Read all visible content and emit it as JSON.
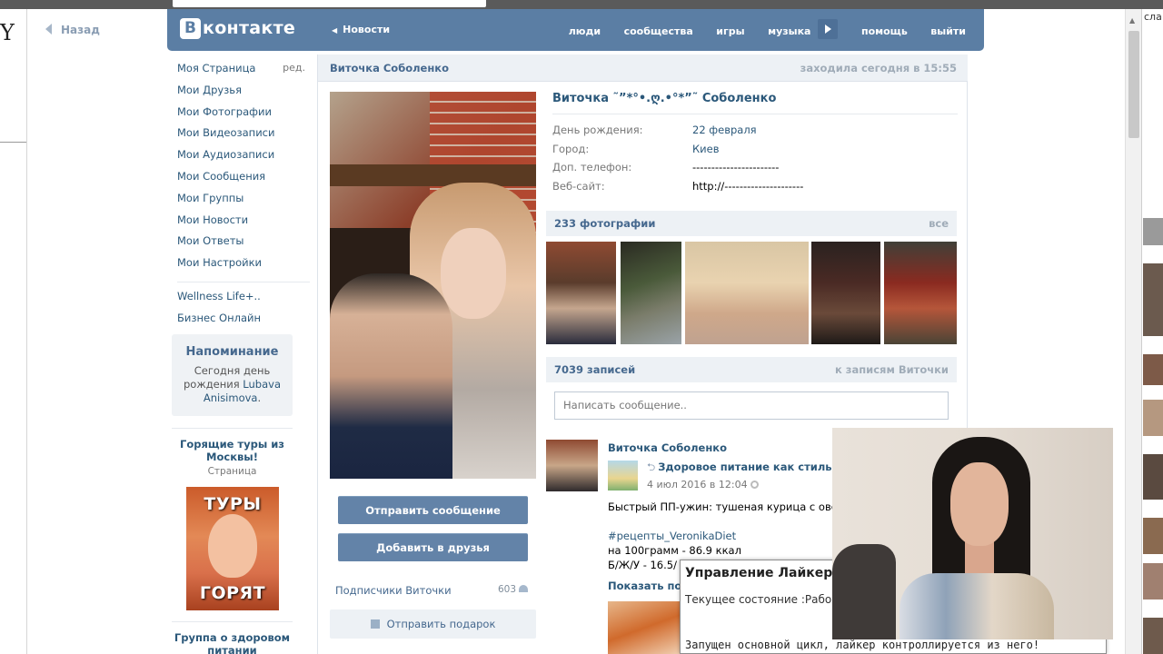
{
  "browser": {
    "back_label": "Назад",
    "left_letter": "Y",
    "right_fragment": "сла"
  },
  "vk": {
    "logo_letter": "В",
    "logo_text": "контакте",
    "news_link": "Новости",
    "nav": [
      "люди",
      "сообщества",
      "игры",
      "музыка",
      "помощь",
      "выйти"
    ]
  },
  "left_menu": {
    "items": [
      "Моя Страница",
      "Мои Друзья",
      "Мои Фотографии",
      "Мои Видеозаписи",
      "Мои Аудиозаписи",
      "Мои Сообщения",
      "Мои Группы",
      "Мои Новости",
      "Мои Ответы",
      "Мои Настройки"
    ],
    "edit_label": "ред.",
    "apps": [
      "Wellness Life+..",
      "Бизнес Онлайн"
    ]
  },
  "reminder": {
    "title": "Напоминание",
    "text_before": "Сегодня день рождения",
    "name": "Lubava Anisimova",
    "text_after": "."
  },
  "ads": {
    "ad1_title": "Горящие туры из Москвы!",
    "ad1_sub": "Страница",
    "ad1_img_top": "ТУРЫ",
    "ad1_img_bottom": "ГОРЯТ",
    "ad2_title": "Группа о здоровом питании"
  },
  "profile": {
    "header_name": "Виточка Соболенко",
    "last_seen": "заходила сегодня в 15:55",
    "full_name": "Виточка ˜”*°•.ღ.•°*”˜ Соболенко",
    "fields": [
      {
        "key": "День рождения:",
        "value": "22 февраля",
        "link": true
      },
      {
        "key": "Город:",
        "value": "Киев",
        "link": true
      },
      {
        "key": "Доп. телефон:",
        "value": "-----------------------",
        "link": false
      },
      {
        "key": "Веб-сайт:",
        "value": "http://---------------------",
        "link": false
      }
    ],
    "send_message": "Отправить сообщение",
    "add_friend": "Добавить в друзья",
    "subscribers_label": "Подписчики Виточки",
    "subscribers_count": "603",
    "send_gift": "Отправить подарок"
  },
  "photos": {
    "title": "233 фотографии",
    "all_link": "все"
  },
  "wall": {
    "title": "7039 записей",
    "to_wall": "к записям Виточки",
    "placeholder": "Написать сообщение..",
    "post": {
      "author": "Виточка Соболенко",
      "share_title": "Здоровое питание как стиль",
      "date": "4 июл 2016 в 12:04",
      "lines": [
        "Быстрый ПП-ужин: тушеная курица с овощ",
        "",
        "#рецепты_VeronikaDiet",
        "на 100грамм - 86.9 ккал",
        "Б/Ж/У - 16.5/"
      ],
      "show_full": "Показать по"
    }
  },
  "liker": {
    "title": "Управление Лайкер",
    "state": "Текущее состояние :Рабо",
    "log": "Запущен основной цикл, лайкер контроллируется из него!"
  },
  "colors": {
    "vk_blue": "#5b7ea4",
    "link": "#2b587a",
    "button": "#6383a8",
    "section_bg": "#edf1f5"
  }
}
